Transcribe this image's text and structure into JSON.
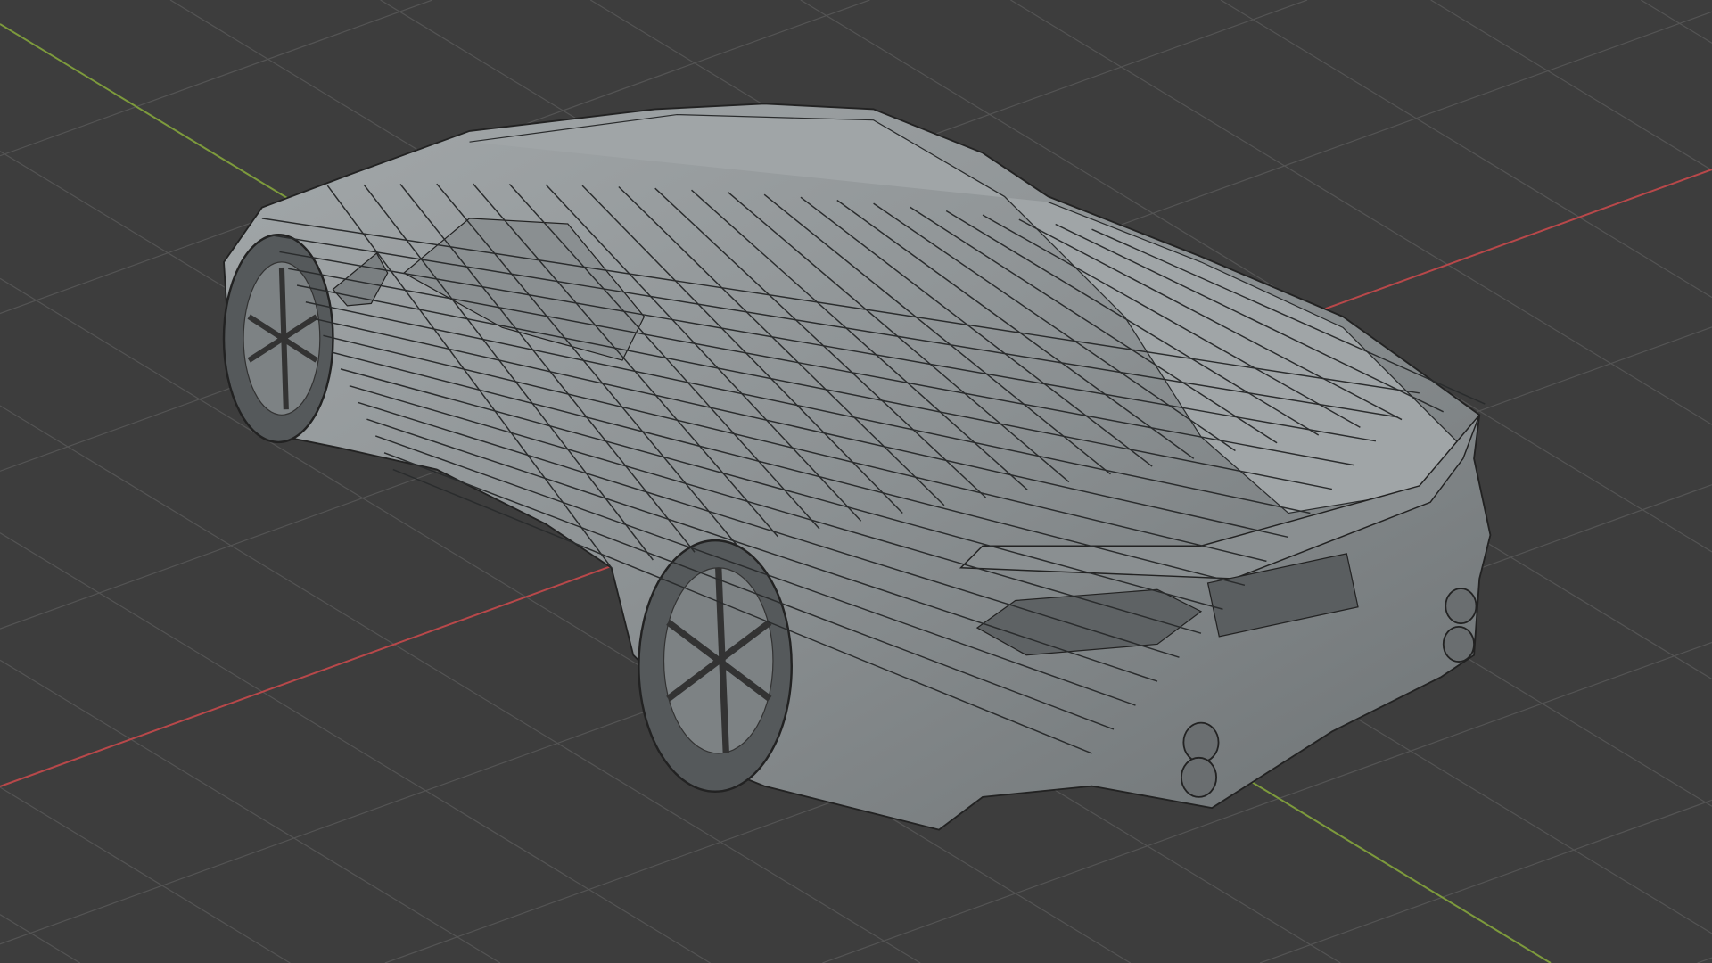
{
  "viewport": {
    "background": "#3d3d3d",
    "grid_color": "#545454",
    "axis_colors": {
      "x": "#b8484a",
      "y": "#7d9a3c"
    },
    "model_color": "#8f9496",
    "wire_color": "#2a2c2d"
  }
}
